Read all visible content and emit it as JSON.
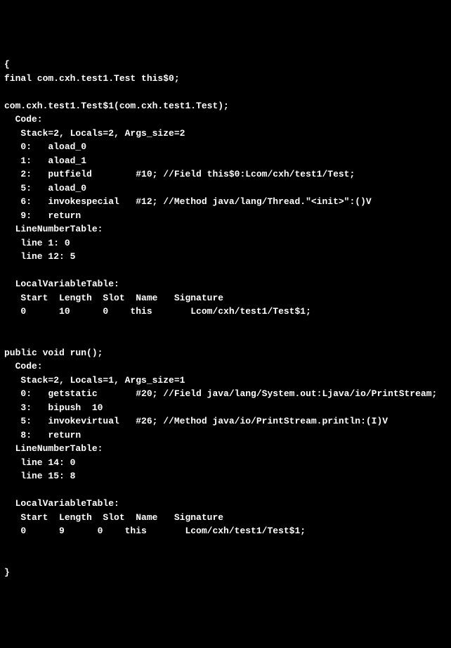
{
  "lines": [
    "{",
    "final com.cxh.test1.Test this$0;",
    "",
    "com.cxh.test1.Test$1(com.cxh.test1.Test);",
    "  Code:",
    "   Stack=2, Locals=2, Args_size=2",
    "   0:   aload_0",
    "   1:   aload_1",
    "   2:   putfield        #10; //Field this$0:Lcom/cxh/test1/Test;",
    "   5:   aload_0",
    "   6:   invokespecial   #12; //Method java/lang/Thread.\"<init>\":()V",
    "   9:   return",
    "  LineNumberTable:",
    "   line 1: 0",
    "   line 12: 5",
    "",
    "  LocalVariableTable:",
    "   Start  Length  Slot  Name   Signature",
    "   0      10      0    this       Lcom/cxh/test1/Test$1;",
    "",
    "",
    "public void run();",
    "  Code:",
    "   Stack=2, Locals=1, Args_size=1",
    "   0:   getstatic       #20; //Field java/lang/System.out:Ljava/io/PrintStream;",
    "   3:   bipush  10",
    "   5:   invokevirtual   #26; //Method java/io/PrintStream.println:(I)V",
    "   8:   return",
    "  LineNumberTable:",
    "   line 14: 0",
    "   line 15: 8",
    "",
    "  LocalVariableTable:",
    "   Start  Length  Slot  Name   Signature",
    "   0      9      0    this       Lcom/cxh/test1/Test$1;",
    "",
    "",
    "}"
  ]
}
